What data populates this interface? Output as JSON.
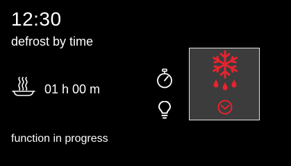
{
  "header": {
    "clock": "12:30",
    "mode": "defrost by time"
  },
  "program": {
    "duration": "01 h 00 m",
    "status": "function in progress",
    "icon": "defrost-snowflake-drops-icon"
  },
  "icons": {
    "dish": "dish-steam-icon",
    "timer": "stopwatch-icon",
    "light": "light-bulb-icon",
    "timer_overlay": "clock-icon"
  },
  "colors": {
    "background": "#000000",
    "text": "#ffffff",
    "accent": "#e8232d",
    "tile_background": "#3c3c3c",
    "tile_border": "#e8e8e8"
  }
}
